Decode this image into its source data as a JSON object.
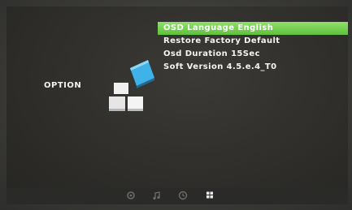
{
  "osd": {
    "section_label": "OPTION",
    "menu_items": [
      {
        "label": "OSD Language English",
        "selected": true
      },
      {
        "label": "Restore Factory Default",
        "selected": false
      },
      {
        "label": "Osd Duration 15Sec",
        "selected": false
      },
      {
        "label": "Soft Version 4.5.e.4_T0",
        "selected": false
      }
    ],
    "highlight_color": "#6fcb46",
    "icon_accent_color": "#3fb2e8",
    "bottom_nav": [
      {
        "icon": "picture-icon",
        "active": false
      },
      {
        "icon": "music-icon",
        "active": false
      },
      {
        "icon": "time-icon",
        "active": false
      },
      {
        "icon": "option-icon",
        "active": true
      }
    ]
  }
}
